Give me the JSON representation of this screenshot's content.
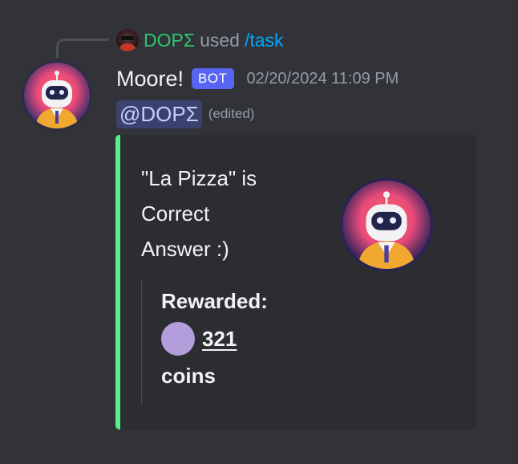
{
  "reply": {
    "username": "DOPΣ",
    "used_text": "used",
    "command": "/task"
  },
  "message": {
    "author": "Moore!",
    "bot_tag": "BOT",
    "timestamp": "02/20/2024 11:09 PM",
    "mention": "@DOPΣ",
    "edited": "(edited)"
  },
  "embed": {
    "accent_color": "#57f287",
    "description_lines": [
      "\"La Pizza\" is",
      "Correct",
      "Answer :)"
    ],
    "field": {
      "title": "Rewarded:",
      "coin_icon": "coin-icon",
      "amount": "321",
      "unit": "coins"
    }
  },
  "colors": {
    "background": "#323339",
    "embed_background": "#2b2d31",
    "reply_username": "#2dc770",
    "command_link": "#00a8fc",
    "bot_tag": "#5865f2",
    "mention_background": "#3c4270",
    "coin": "#b39ddb"
  }
}
